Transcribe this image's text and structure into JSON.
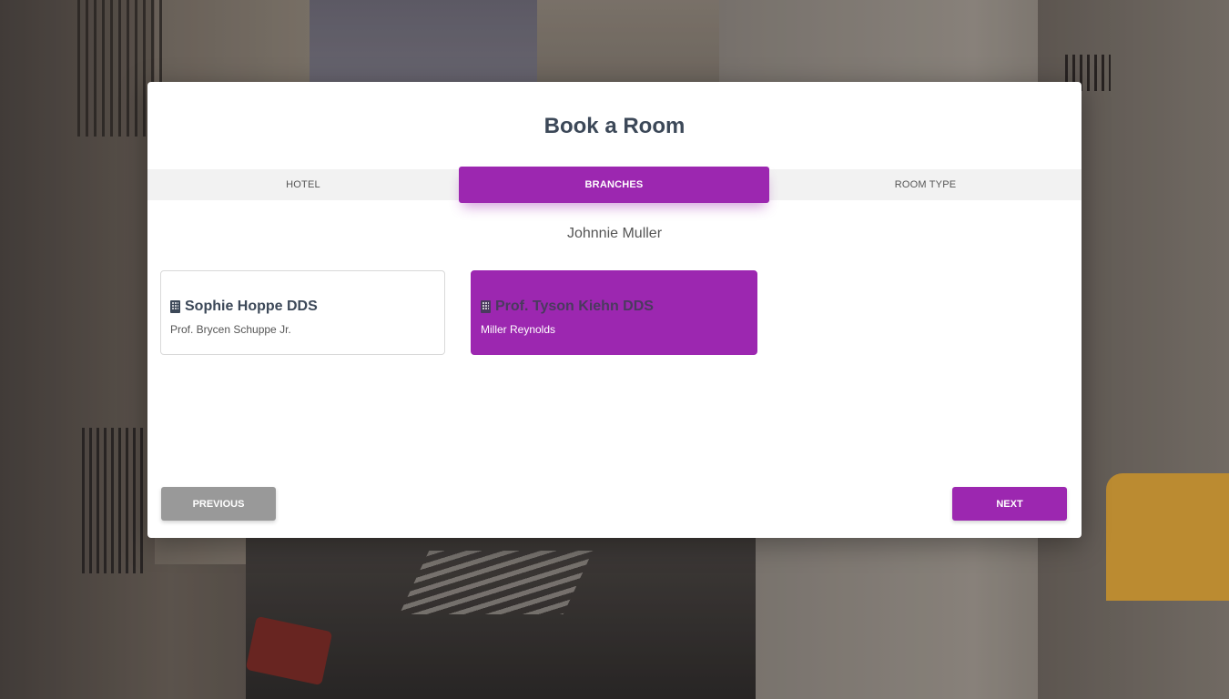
{
  "modal": {
    "title": "Book a Room"
  },
  "tabs": [
    {
      "label": "HOTEL",
      "active": false
    },
    {
      "label": "BRANCHES",
      "active": true
    },
    {
      "label": "ROOM TYPE",
      "active": false
    }
  ],
  "selected_hotel": "Johnnie Muller",
  "branches": [
    {
      "name": "Sophie Hoppe DDS",
      "manager": "Prof. Brycen Schuppe Jr.",
      "selected": false,
      "icon": "building-icon"
    },
    {
      "name": "Prof. Tyson Kiehn DDS",
      "manager": "Miller Reynolds",
      "selected": true,
      "icon": "building-icon"
    }
  ],
  "buttons": {
    "previous": "PREVIOUS",
    "next": "NEXT"
  },
  "colors": {
    "accent": "#9c27b0",
    "previous_button": "#999999",
    "title_text": "#3c4858"
  }
}
